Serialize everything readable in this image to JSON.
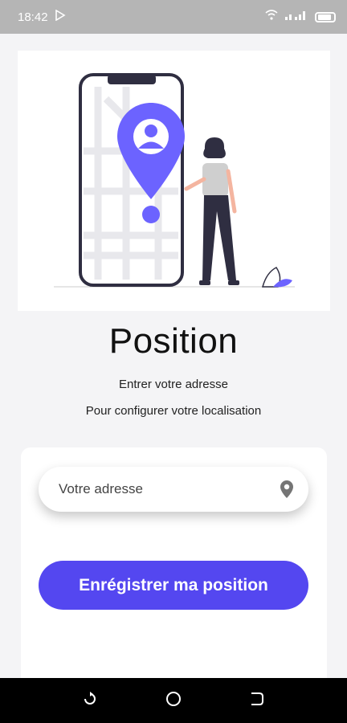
{
  "status_bar": {
    "time": "18:42",
    "icons": [
      "play-store-icon",
      "wifi-icon",
      "signal-icon",
      "battery-icon"
    ]
  },
  "illustration": {
    "name": "location-illustration",
    "accent_color": "#6c63ff"
  },
  "page": {
    "title": "Position",
    "subtitle_1": "Entrer votre adresse",
    "subtitle_2": "Pour configurer votre localisation"
  },
  "form": {
    "address_placeholder": "Votre adresse",
    "address_value": "",
    "location_icon": "location-pin-icon",
    "save_label": "Enrégistrer ma position"
  },
  "colors": {
    "primary": "#5447f0",
    "status_bar": "#b5b5b5",
    "nav_bar": "#000000"
  },
  "nav_bar": {
    "buttons": [
      "recent-apps-icon",
      "home-icon",
      "back-icon"
    ]
  }
}
